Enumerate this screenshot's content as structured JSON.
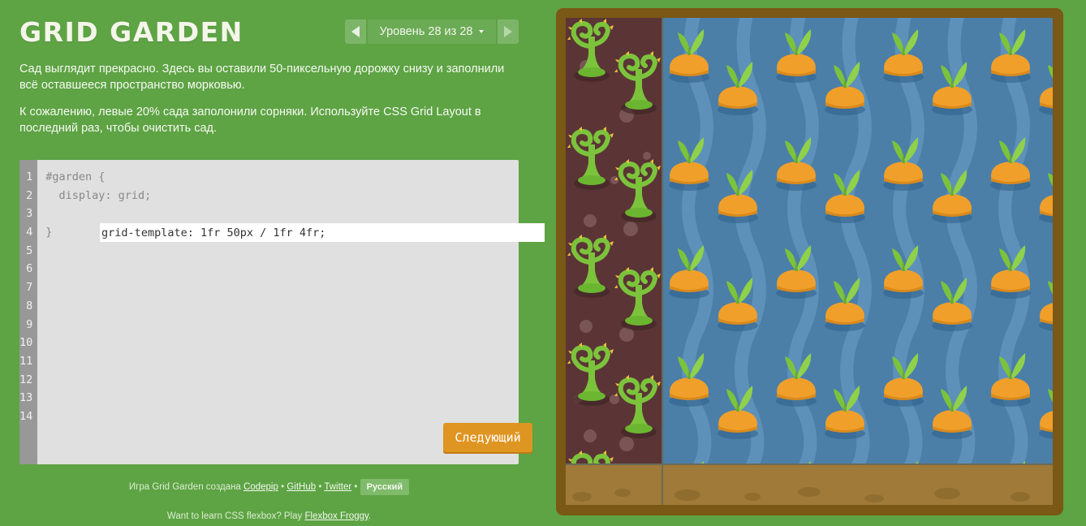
{
  "app": {
    "title": "GRID GARDEN"
  },
  "level_nav": {
    "label": "Уровень 28 из 28"
  },
  "instructions": [
    "Сад выглядит прекрасно. Здесь вы оставили 50-пиксельную дорожку снизу и заполнили всё оставшееся пространство морковью.",
    "К сожалению, левые 20% сада заполонили сорняки. Используйте CSS Grid Layout в последний раз, чтобы очистить сад."
  ],
  "editor": {
    "line_numbers": [
      "1",
      "2",
      "3",
      "4",
      "5",
      "6",
      "7",
      "8",
      "9",
      "10",
      "11",
      "12",
      "13",
      "14"
    ],
    "line1": "#garden {",
    "line2": "  display: grid;",
    "input_value": "grid-template: 1fr 50px / 1fr 4fr;",
    "line4": "}",
    "next_label": "Следующий"
  },
  "credits": {
    "prefix": "Игра Grid Garden создана",
    "codepip": "Codepip",
    "github": "GitHub",
    "twitter": "Twitter",
    "sep": "•",
    "language": "Русский"
  },
  "froggy": {
    "prefix": "Want to learn CSS flexbox? Play",
    "link": "Flexbox Froggy",
    "suffix": "."
  },
  "colors": {
    "background": "#5ea344",
    "water": "#4b7fa8",
    "soil": "#5b3536",
    "weed": "#7cc33c",
    "carrot": "#f0a02a",
    "path": "#a07a38",
    "frame": "#7a5815",
    "next_button": "#df9521"
  },
  "garden": {
    "weed_icon": "weed-icon",
    "carrot_icon": "carrot-icon"
  }
}
